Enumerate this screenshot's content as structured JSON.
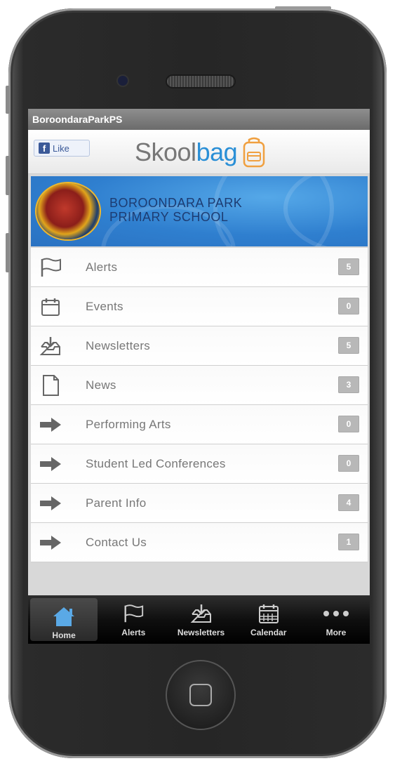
{
  "app": {
    "title": "BoroondaraParkPS"
  },
  "header": {
    "fb_like": "Like",
    "logo_part1": "Skool",
    "logo_part2": "bag"
  },
  "banner": {
    "line1": "BOROONDARA PARK",
    "line2": "PRIMARY SCHOOL"
  },
  "menu": [
    {
      "label": "Alerts",
      "count": "5",
      "icon": "flag-icon"
    },
    {
      "label": "Events",
      "count": "0",
      "icon": "calendar-icon"
    },
    {
      "label": "Newsletters",
      "count": "5",
      "icon": "inbox-download-icon"
    },
    {
      "label": "News",
      "count": "3",
      "icon": "document-icon"
    },
    {
      "label": "Performing Arts",
      "count": "0",
      "icon": "arrow-right-icon"
    },
    {
      "label": "Student Led Conferences",
      "count": "0",
      "icon": "arrow-right-icon"
    },
    {
      "label": "Parent Info",
      "count": "4",
      "icon": "arrow-right-icon"
    },
    {
      "label": "Contact Us",
      "count": "1",
      "icon": "arrow-right-icon"
    }
  ],
  "tabs": [
    {
      "label": "Home",
      "icon": "home-icon",
      "active": true
    },
    {
      "label": "Alerts",
      "icon": "flag-icon"
    },
    {
      "label": "Newsletters",
      "icon": "inbox-download-icon"
    },
    {
      "label": "Calendar",
      "icon": "calendar-icon"
    },
    {
      "label": "More",
      "icon": "more-dots-icon"
    }
  ],
  "colors": {
    "accent": "#2a8fd6",
    "banner": "#2f7fcf",
    "facebook": "#3b5998"
  }
}
